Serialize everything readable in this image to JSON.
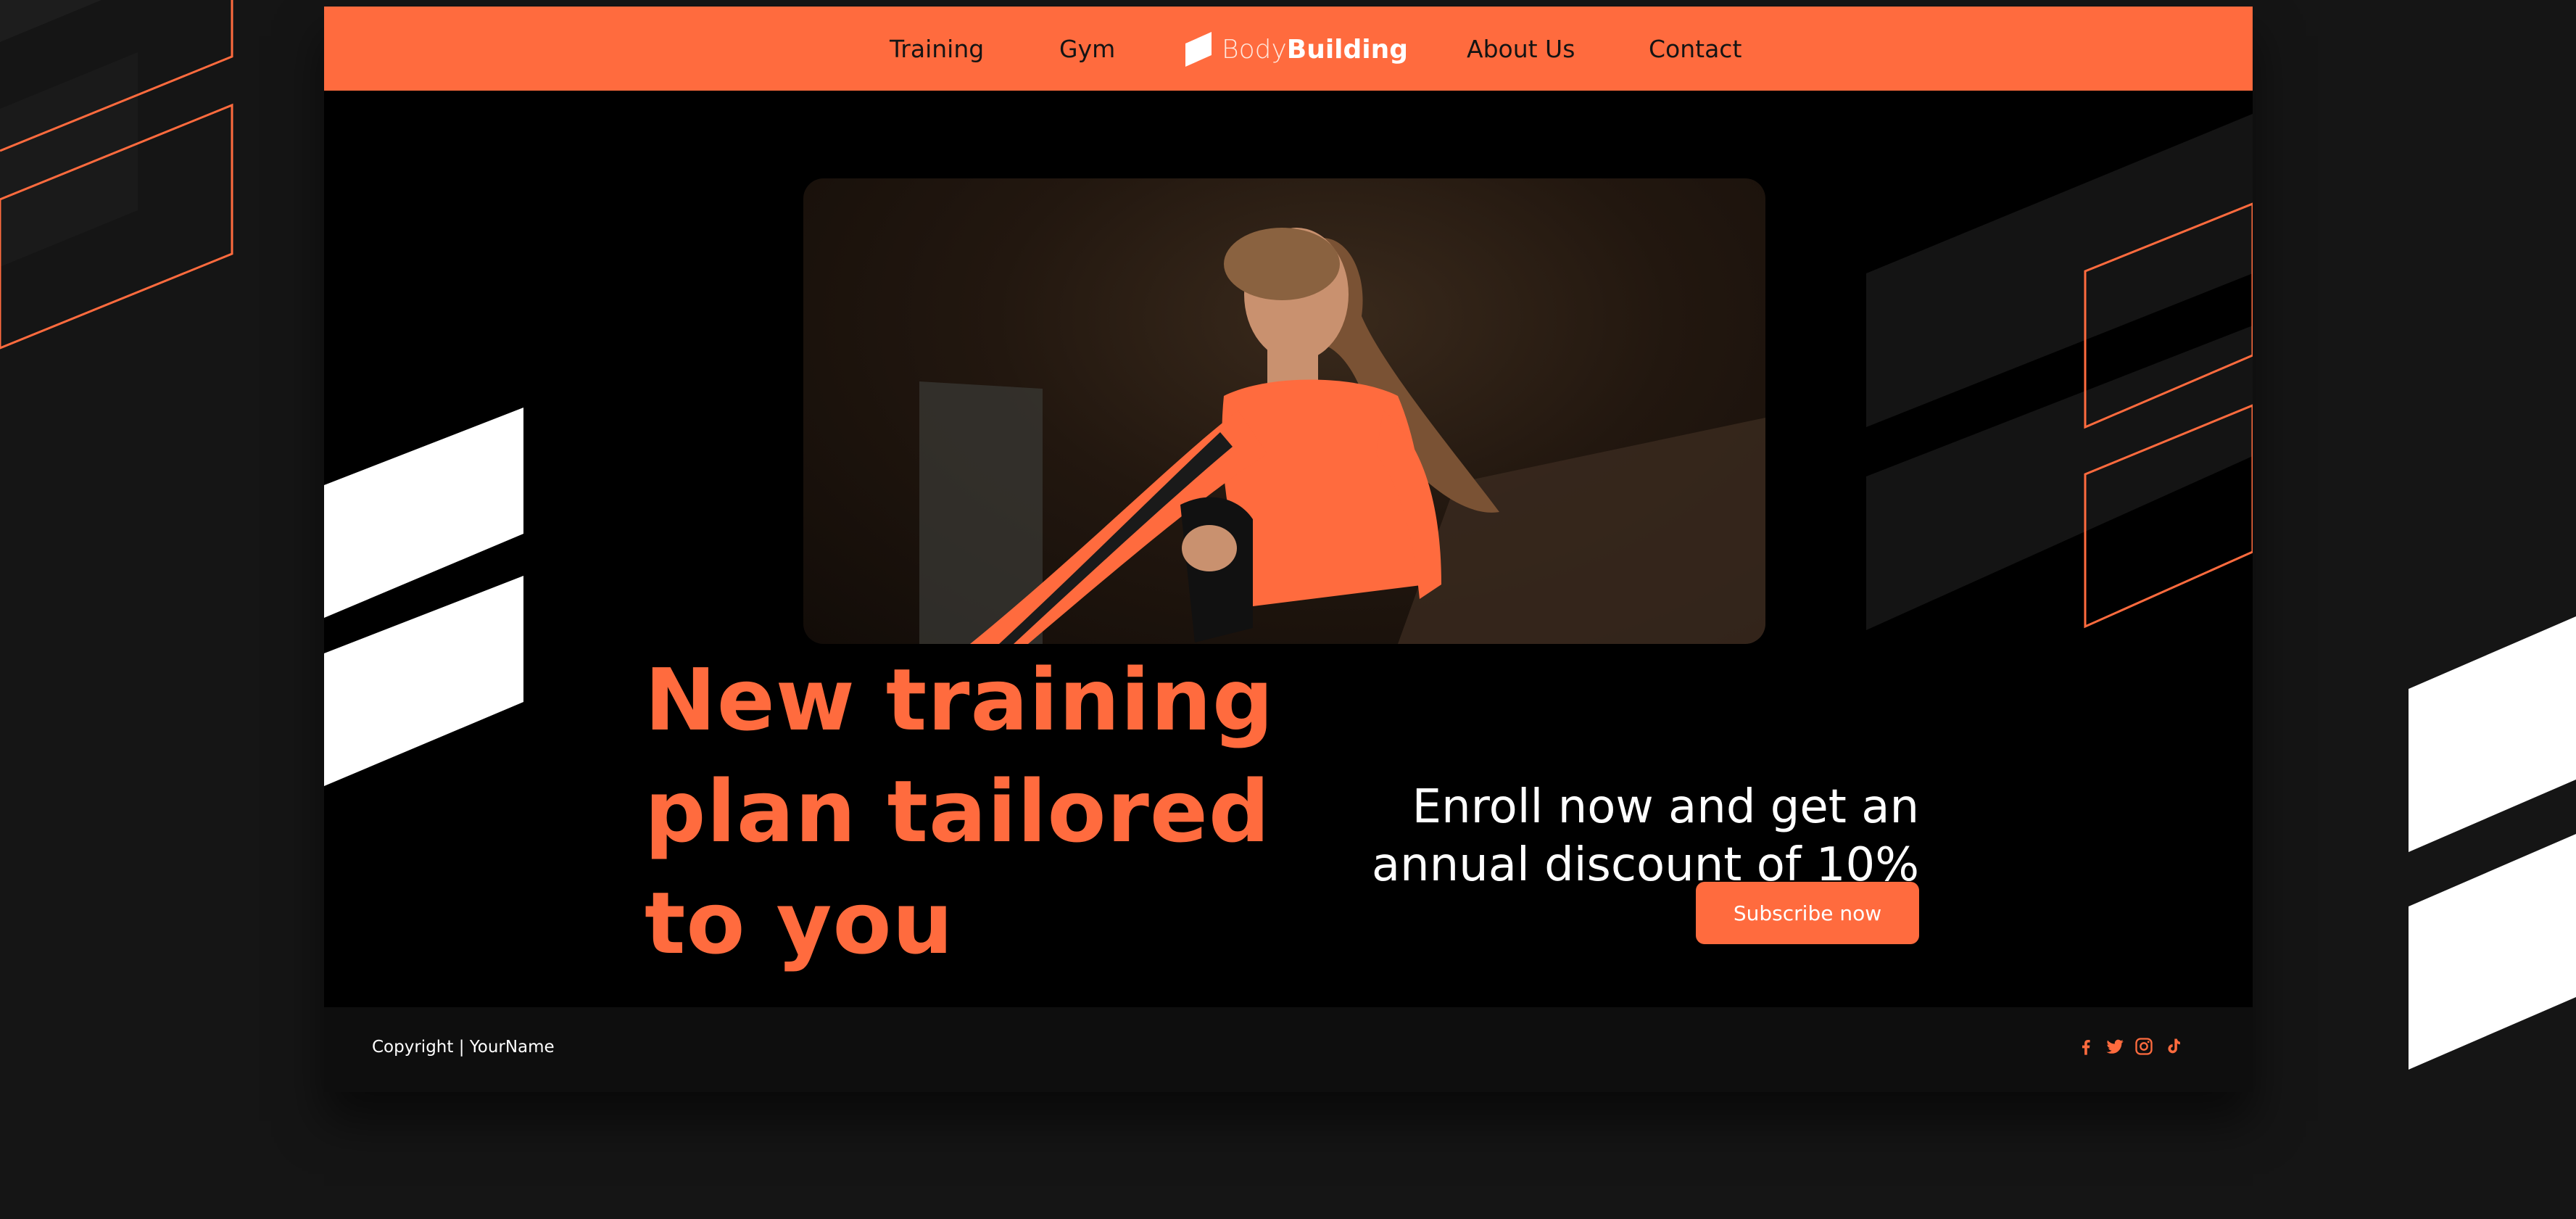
{
  "colors": {
    "accent": "#FF6B3E",
    "background": "#151515",
    "card": "#000000",
    "footer": "#0E0E0E"
  },
  "nav": {
    "items": [
      {
        "label": "Training"
      },
      {
        "label": "Gym"
      },
      {
        "label": "About Us"
      },
      {
        "label": "Contact"
      }
    ],
    "logo": {
      "light": "Body",
      "bold": "Building",
      "icon": "bodybuilding-logo-icon"
    }
  },
  "hero": {
    "headline": [
      "New training",
      "plan tailored",
      "to you"
    ],
    "offer": [
      "Enroll now and get an",
      "annual discount of 10%"
    ],
    "cta_label": "Subscribe now",
    "image_subject": "athlete-running-photo"
  },
  "footer": {
    "copyright": "Copyright | YourName",
    "social_icons": [
      "facebook-icon",
      "twitter-icon",
      "instagram-icon",
      "tiktok-icon"
    ]
  }
}
